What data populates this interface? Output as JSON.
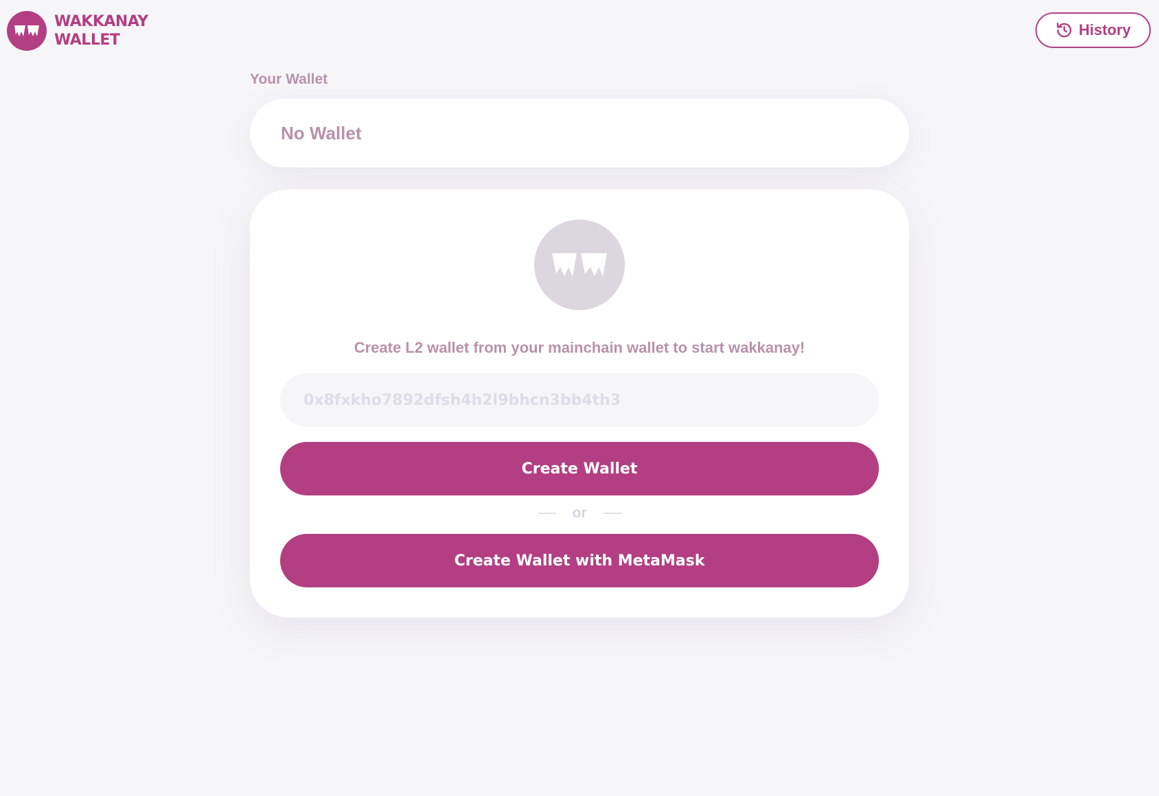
{
  "header": {
    "logo": {
      "line1": "WAKKANAY",
      "line2": "WALLET"
    },
    "history_button": {
      "label": "History",
      "icon": "history-icon"
    }
  },
  "wallet": {
    "label": "Your Wallet",
    "value": "No Wallet"
  },
  "create_card": {
    "avatar_icon": "wakkanay-logo-icon",
    "message": "Create L2 wallet from your mainchain wallet to start wakkanay!",
    "address_placeholder": "0x8fxkho7892dfsh4h2l9bhcn3bb4th3",
    "address_value": "",
    "create_button_label": "Create Wallet",
    "divider_label": "or",
    "metamask_button_label": "Create Wallet with MetaMask"
  },
  "colors": {
    "brand": "#b33e82",
    "muted_text": "#b891aa",
    "background": "#f6f6f9",
    "avatar_bg": "#dcd6df"
  }
}
